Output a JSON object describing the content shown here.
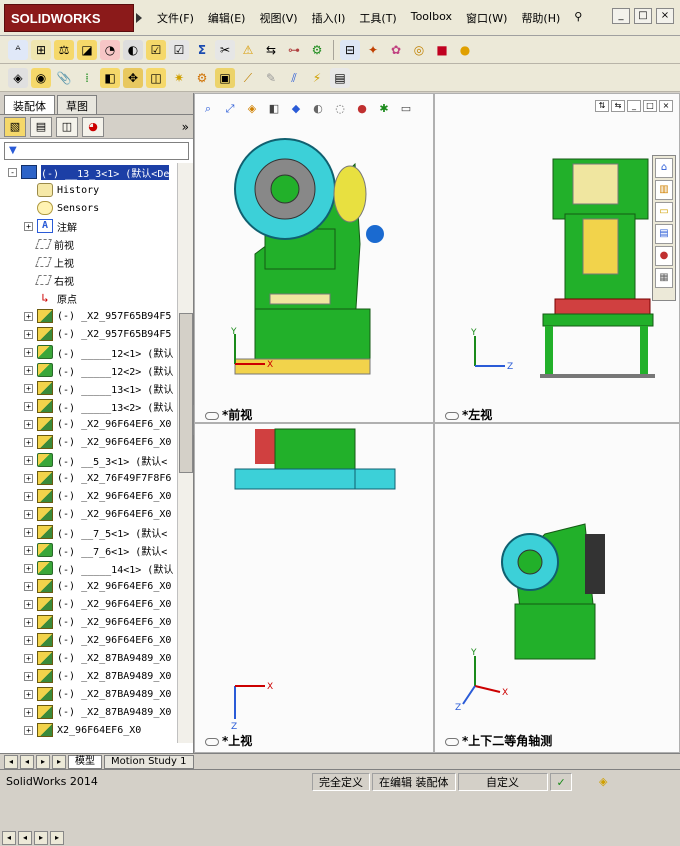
{
  "app": {
    "logo_text": "SOLIDWORKS",
    "menu": [
      "文件(F)",
      "编辑(E)",
      "视图(V)",
      "插入(I)",
      "工具(T)",
      "Toolbox",
      "窗口(W)",
      "帮助(H)"
    ]
  },
  "window_controls": [
    "_",
    "□",
    "×"
  ],
  "panel": {
    "tabs": [
      "装配体",
      "草图"
    ],
    "filter_symbol": "▼",
    "tree": [
      {
        "label": "(-)  __13_3<1> (默认<De",
        "icon": "root",
        "expand": "-",
        "selected": true,
        "indent": 0
      },
      {
        "label": "History",
        "icon": "history",
        "expand": "",
        "indent": 1
      },
      {
        "label": "Sensors",
        "icon": "sensors",
        "expand": "",
        "indent": 1
      },
      {
        "label": "注解",
        "icon": "annotation",
        "expand": "+",
        "indent": 1
      },
      {
        "label": "前视",
        "icon": "plane",
        "expand": "",
        "indent": 1
      },
      {
        "label": "上视",
        "icon": "plane",
        "expand": "",
        "indent": 1
      },
      {
        "label": "右视",
        "icon": "plane",
        "expand": "",
        "indent": 1
      },
      {
        "label": "原点",
        "icon": "origin",
        "expand": "",
        "indent": 1
      },
      {
        "label": "(-)  _X2_957F65B94F5",
        "icon": "part",
        "expand": "+",
        "indent": 1
      },
      {
        "label": "(-)  _X2_957F65B94F5",
        "icon": "part",
        "expand": "+",
        "indent": 1
      },
      {
        "label": "(-)  _____12<1> (默认",
        "icon": "assembly",
        "expand": "+",
        "indent": 1
      },
      {
        "label": "(-)  _____12<2> (默认",
        "icon": "assembly",
        "expand": "+",
        "indent": 1
      },
      {
        "label": "(-)  _____13<1> (默认",
        "icon": "part",
        "expand": "+",
        "indent": 1
      },
      {
        "label": "(-)  _____13<2> (默认",
        "icon": "part",
        "expand": "+",
        "indent": 1
      },
      {
        "label": "(-)  _X2_96F64EF6_X0",
        "icon": "part",
        "expand": "+",
        "indent": 1
      },
      {
        "label": "(-)  _X2_96F64EF6_X0",
        "icon": "part",
        "expand": "+",
        "indent": 1
      },
      {
        "label": "(-)  __5_3<1> (默认<",
        "icon": "assembly",
        "expand": "+",
        "indent": 1
      },
      {
        "label": "(-)  _X2_76F49F7F8F6",
        "icon": "part",
        "expand": "+",
        "indent": 1
      },
      {
        "label": "(-)  _X2_96F64EF6_X0",
        "icon": "part",
        "expand": "+",
        "indent": 1
      },
      {
        "label": "(-)  _X2_96F64EF6_X0",
        "icon": "part",
        "expand": "+",
        "indent": 1
      },
      {
        "label": "(-)  __7_5<1> (默认<",
        "icon": "part",
        "expand": "+",
        "indent": 1
      },
      {
        "label": "(-)  __7_6<1> (默认<",
        "icon": "assembly",
        "expand": "+",
        "indent": 1
      },
      {
        "label": "(-)  _____14<1> (默认",
        "icon": "assembly",
        "expand": "+",
        "indent": 1
      },
      {
        "label": "(-)  _X2_96F64EF6_X0",
        "icon": "part",
        "expand": "+",
        "indent": 1
      },
      {
        "label": "(-)  _X2_96F64EF6_X0",
        "icon": "part",
        "expand": "+",
        "indent": 1
      },
      {
        "label": "(-)  _X2_96F64EF6_X0",
        "icon": "part",
        "expand": "+",
        "indent": 1
      },
      {
        "label": "(-)  _X2_96F64EF6_X0",
        "icon": "part",
        "expand": "+",
        "indent": 1
      },
      {
        "label": "(-)  _X2_87BA9489_X0",
        "icon": "part",
        "expand": "+",
        "indent": 1
      },
      {
        "label": "(-)  _X2_87BA9489_X0",
        "icon": "part",
        "expand": "+",
        "indent": 1
      },
      {
        "label": "(-)  _X2_87BA9489_X0",
        "icon": "part",
        "expand": "+",
        "indent": 1
      },
      {
        "label": "(-)  _X2_87BA9489_X0",
        "icon": "part",
        "expand": "+",
        "indent": 1
      },
      {
        "label": "X2_96F64EF6_X0",
        "icon": "part",
        "expand": "+",
        "indent": 1
      }
    ]
  },
  "viewports": {
    "front": "*前视",
    "left": "*左视",
    "top": "*上视",
    "iso": "*上下二等角轴测"
  },
  "axes": {
    "x": "X",
    "y": "Y",
    "z": "Z"
  },
  "sheet_tabs": [
    "模型",
    "Motion Study 1"
  ],
  "status": {
    "app_version": "SolidWorks 2014",
    "definition": "完全定义",
    "mode": "在编辑 装配体",
    "custom": "自定义"
  },
  "colors": {
    "machine_green": "#22b02a",
    "flywheel_cyan": "#3cd0d8",
    "accent_blue": "#1c3fa6"
  }
}
